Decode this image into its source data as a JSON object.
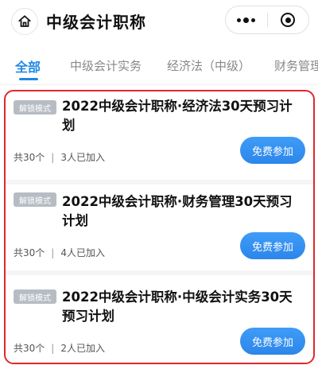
{
  "header": {
    "title": "中级会计职称",
    "home_icon": "home-icon",
    "more_icon": "more-dots-icon",
    "close_icon": "target-close-icon"
  },
  "tabs": [
    {
      "label": "全部",
      "active": true
    },
    {
      "label": "中级会计实务",
      "active": false
    },
    {
      "label": "经济法（中级）",
      "active": false
    },
    {
      "label": "财务管理",
      "active": false
    }
  ],
  "cards": [
    {
      "badge": "解锁模式",
      "title": "2022中级会计职称·经济法30天预习计划",
      "count": "共30个",
      "joined": "3人已加入",
      "button": "免费参加"
    },
    {
      "badge": "解锁模式",
      "title": "2022中级会计职称·财务管理30天预习计划",
      "count": "共30个",
      "joined": "4人已加入",
      "button": "免费参加"
    },
    {
      "badge": "解锁模式",
      "title": "2022中级会计职称·中级会计实务30天预习计划",
      "count": "共30个",
      "joined": "2人已加入",
      "button": "免费参加"
    }
  ],
  "colors": {
    "accent": "#1e88e5",
    "highlight_border": "#e0282e",
    "badge_bg": "#b7bcc4",
    "button_bg": "#2c86ea"
  }
}
